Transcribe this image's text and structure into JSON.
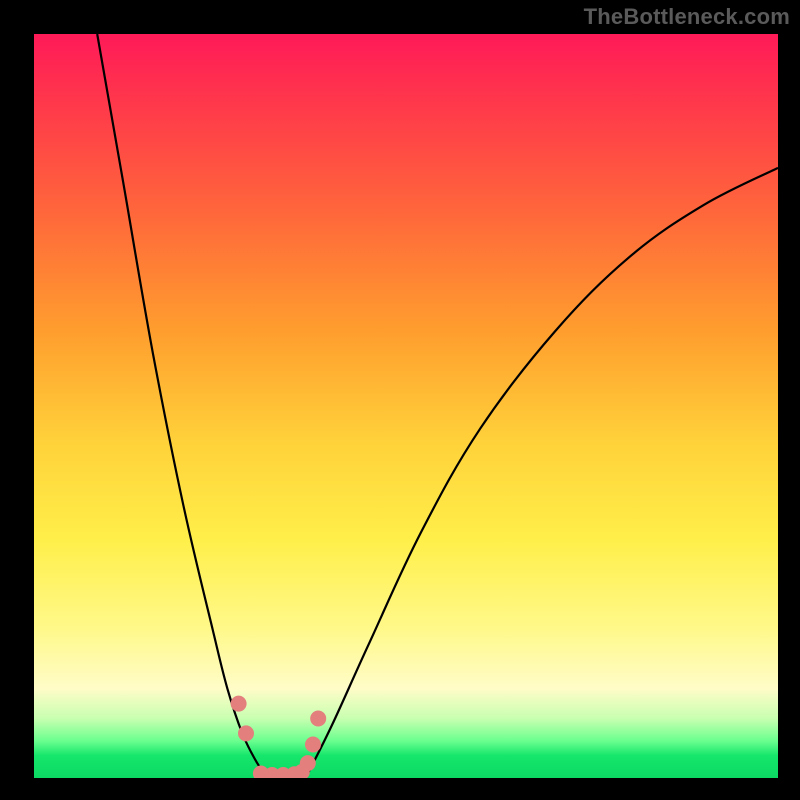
{
  "watermark": {
    "text": "TheBottleneck.com"
  },
  "chart_data": {
    "type": "line",
    "title": "",
    "xlabel": "",
    "ylabel": "",
    "xlim": [
      0,
      100
    ],
    "ylim": [
      0,
      100
    ],
    "grid": false,
    "legend": false,
    "background_gradient": {
      "orientation": "vertical_top_to_bottom",
      "stops": [
        {
          "pos": 0.0,
          "color": "#ff1a58"
        },
        {
          "pos": 0.55,
          "color": "#ffd23a"
        },
        {
          "pos": 0.88,
          "color": "#fffcc8"
        },
        {
          "pos": 1.0,
          "color": "#0bd964"
        }
      ]
    },
    "series": [
      {
        "name": "bottleneck-left",
        "x": [
          8.5,
          12,
          16,
          20,
          24,
          26,
          28,
          30,
          31.5
        ],
        "y": [
          100,
          80,
          57,
          37,
          20,
          12,
          6,
          2,
          0
        ]
      },
      {
        "name": "bottleneck-right",
        "x": [
          36.5,
          40,
          45,
          52,
          60,
          70,
          80,
          90,
          100
        ],
        "y": [
          0,
          7,
          18,
          33,
          47,
          60,
          70,
          77,
          82
        ]
      }
    ],
    "markers": {
      "name": "sweet-spot-dots",
      "color": "#e37f7c",
      "approx_radius_px": 8,
      "x": [
        27.5,
        28.5,
        30.5,
        32.0,
        33.5,
        35.0,
        36.0,
        36.8,
        37.5,
        38.2
      ],
      "y": [
        10.0,
        6.0,
        0.6,
        0.4,
        0.4,
        0.5,
        0.8,
        2.0,
        4.5,
        8.0
      ]
    }
  }
}
